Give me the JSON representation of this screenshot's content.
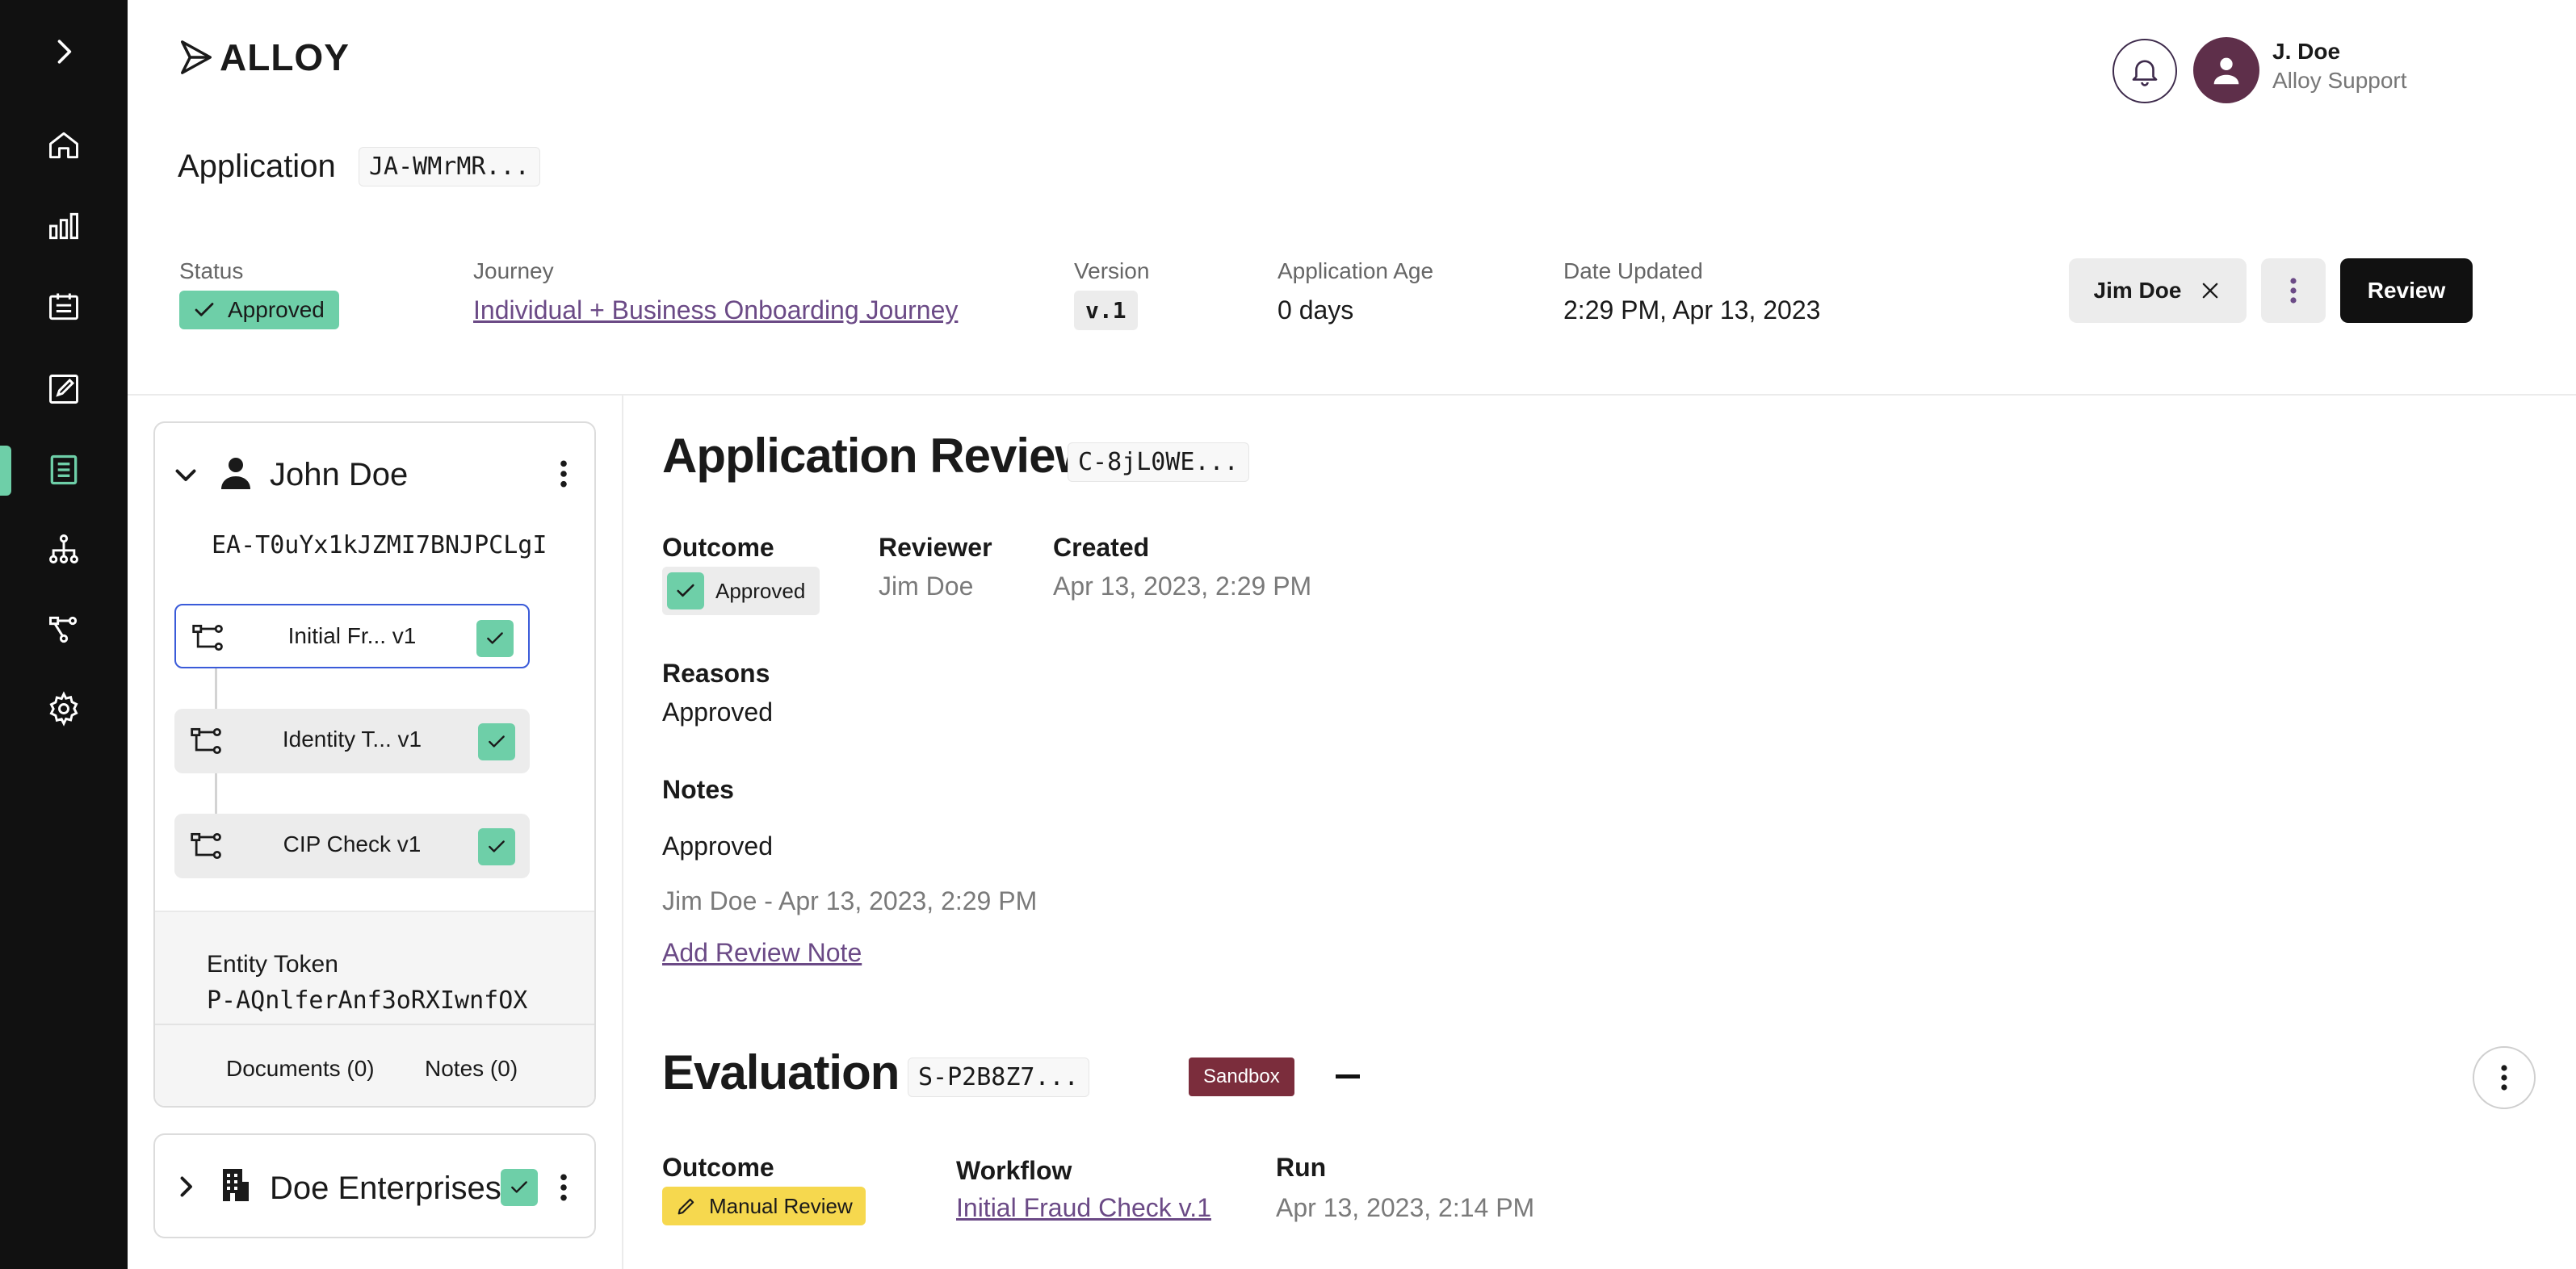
{
  "brand": {
    "logo_text": "ALLOY",
    "accent": "#6ecfa8",
    "sidebar_bg": "#111111"
  },
  "nav": {
    "items": [
      {
        "name": "expand",
        "icon": "chevron-right-icon"
      },
      {
        "name": "home",
        "icon": "home-icon"
      },
      {
        "name": "analytics",
        "icon": "bar-chart-icon"
      },
      {
        "name": "cases",
        "icon": "calendar-list-icon"
      },
      {
        "name": "review",
        "icon": "edit-icon"
      },
      {
        "name": "applications",
        "icon": "document-icon",
        "active": true
      },
      {
        "name": "hierarchy",
        "icon": "org-chart-icon"
      },
      {
        "name": "workflows",
        "icon": "workflow-icon"
      },
      {
        "name": "settings",
        "icon": "gear-icon"
      }
    ]
  },
  "user": {
    "name": "J. Doe",
    "role": "Alloy Support"
  },
  "application": {
    "title": "Application",
    "token": "JA-WMrMR...",
    "status_label": "Status",
    "status": "Approved",
    "journey_label": "Journey",
    "journey": "Individual + Business Onboarding Journey",
    "version_label": "Version",
    "version": "v.1",
    "age_label": "Application Age",
    "age": "0 days",
    "updated_label": "Date Updated",
    "updated": "2:29 PM, Apr 13, 2023"
  },
  "actions": {
    "assignee": "Jim Doe",
    "review_label": "Review"
  },
  "entity": {
    "name": "John Doe",
    "token": "EA-T0uYx1kJZMI7BNJPCLgI",
    "workflows": [
      {
        "label": "Initial Fr... v1",
        "selected": true
      },
      {
        "label": "Identity T... v1",
        "selected": false
      },
      {
        "label": "CIP Check v1",
        "selected": false
      }
    ],
    "entity_token_label": "Entity Token",
    "entity_token": "P-AQnlferAnf3oRXIwnfOX",
    "documents_tab": "Documents (0)",
    "notes_tab": "Notes (0)"
  },
  "business": {
    "name": "Doe Enterprises"
  },
  "review": {
    "title": "Application Review",
    "token": "C-8jL0WE...",
    "outcome_label": "Outcome",
    "outcome": "Approved",
    "reviewer_label": "Reviewer",
    "reviewer": "Jim Doe",
    "created_label": "Created",
    "created": "Apr 13, 2023, 2:29 PM",
    "reasons_label": "Reasons",
    "reasons": "Approved",
    "notes_label": "Notes",
    "note_text": "Approved",
    "note_meta": "Jim Doe - Apr 13, 2023, 2:29 PM",
    "add_note": "Add Review Note"
  },
  "evaluation": {
    "title": "Evaluation",
    "token": "S-P2B8Z7...",
    "sandbox": "Sandbox",
    "outcome_label": "Outcome",
    "outcome": "Manual Review",
    "workflow_label": "Workflow",
    "workflow": "Initial Fraud Check v.1",
    "run_label": "Run",
    "run": "Apr 13, 2023, 2:14 PM"
  }
}
